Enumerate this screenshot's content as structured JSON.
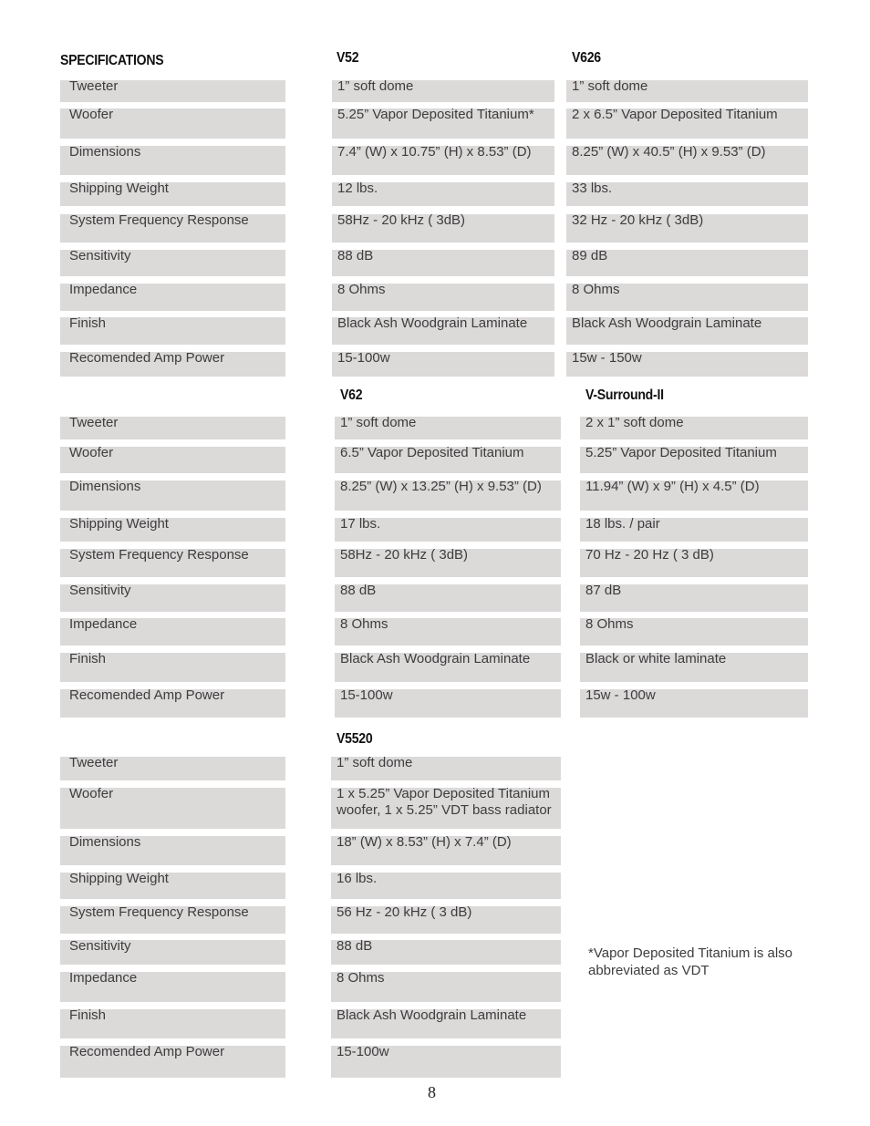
{
  "page_title": "SPECIFICATIONS",
  "row_labels": [
    "Tweeter",
    "Woofer",
    "Dimensions",
    "Shipping Weight",
    "System Frequency Response",
    "Sensitivity",
    "Impedance",
    "Finish",
    "Recomended Amp Power"
  ],
  "models": [
    {
      "name": "V52",
      "values": [
        "1” soft dome",
        "5.25” Vapor Deposited Titanium*",
        "7.4” (W) x 10.75” (H) x 8.53” (D)",
        "12 lbs.",
        "58Hz - 20 kHz ( 3dB)",
        "88 dB",
        "8 Ohms",
        "Black Ash Woodgrain Laminate",
        "15-100w"
      ]
    },
    {
      "name": "V626",
      "values": [
        "1” soft dome",
        "2 x 6.5” Vapor Deposited Titanium",
        "8.25” (W) x 40.5” (H) x 9.53” (D)",
        "33 lbs.",
        "32 Hz - 20 kHz ( 3dB)",
        "89 dB",
        "8 Ohms",
        "Black Ash Woodgrain Laminate",
        "15w - 150w"
      ]
    },
    {
      "name": "V62",
      "values": [
        "1” soft dome",
        "6.5” Vapor Deposited Titanium",
        "8.25” (W) x 13.25” (H) x 9.53” (D)",
        "17 lbs.",
        "58Hz - 20 kHz ( 3dB)",
        "88 dB",
        "8 Ohms",
        "Black Ash Woodgrain Laminate",
        "15-100w"
      ]
    },
    {
      "name": "V-Surround-II",
      "values": [
        "2 x 1” soft dome",
        "5.25” Vapor Deposited Titanium",
        "11.94” (W) x 9” (H) x 4.5” (D)",
        "18 lbs. / pair",
        "70 Hz - 20 Hz ( 3 dB)",
        "87 dB",
        "8 Ohms",
        "Black or white laminate",
        "15w - 100w"
      ]
    },
    {
      "name": "V5520",
      "values": [
        "1” soft dome",
        "1 x 5.25” Vapor Deposited Titanium\nwoofer, 1 x 5.25” VDT bass radiator",
        "18” (W) x 8.53” (H) x 7.4” (D)",
        "16 lbs.",
        "56 Hz - 20 kHz ( 3 dB)",
        "88 dB",
        "8 Ohms",
        "Black Ash Woodgrain Laminate",
        "15-100w"
      ]
    }
  ],
  "footnote": "*Vapor Deposited Titanium is also\nabbreviated as VDT",
  "page_number": "8"
}
